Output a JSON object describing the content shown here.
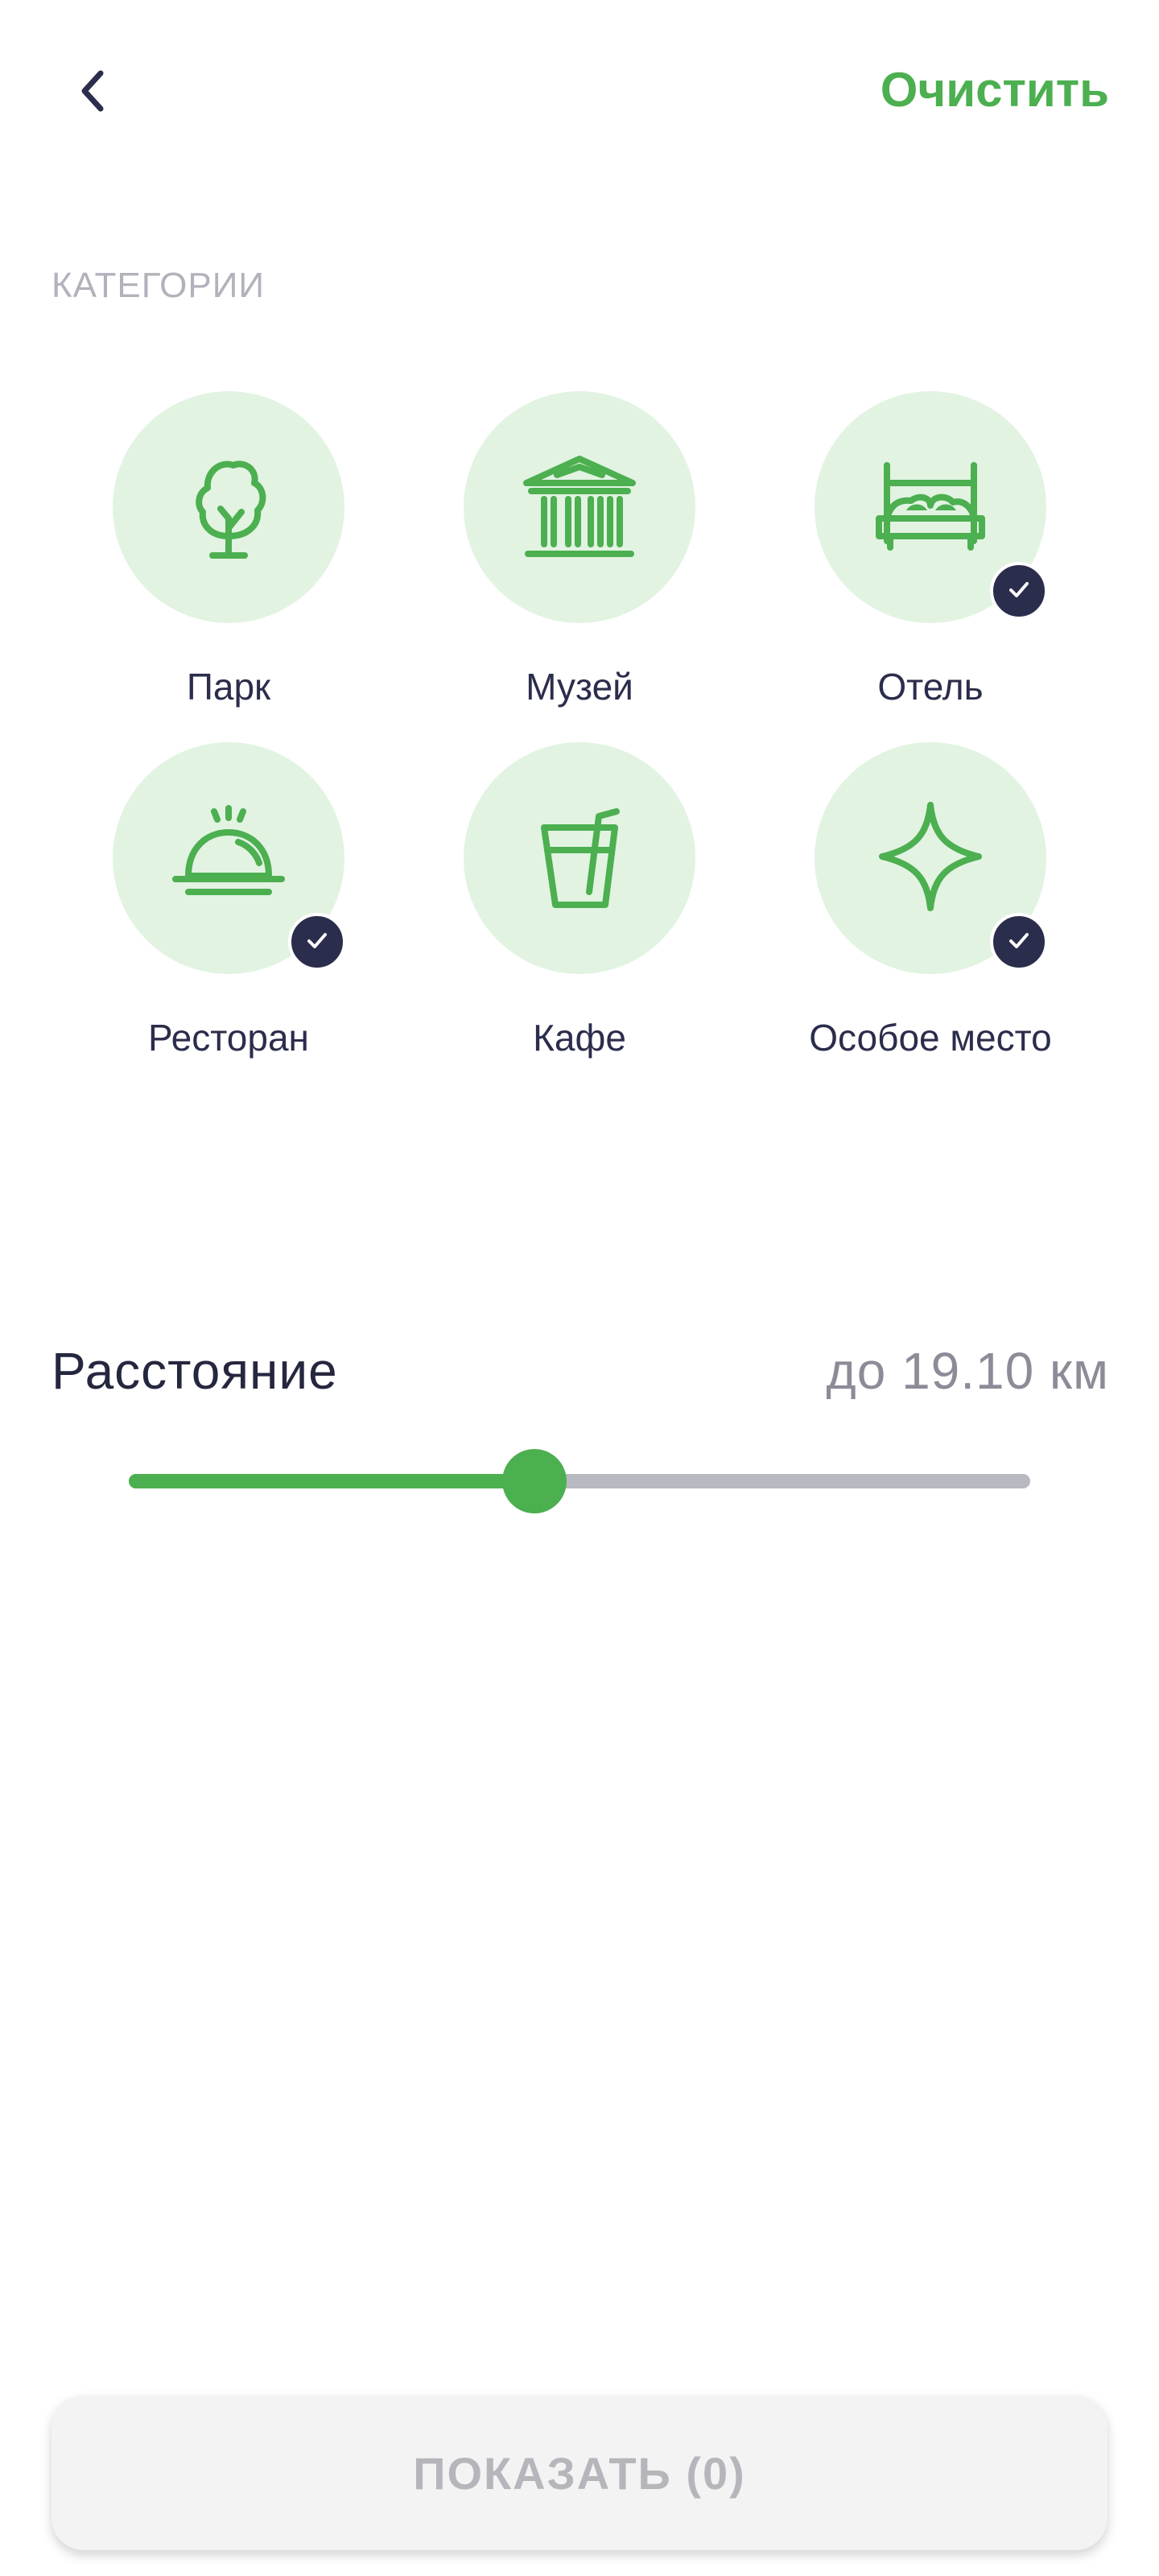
{
  "header": {
    "back_icon": "chevron-left-icon",
    "clear_label": "Очистить"
  },
  "categories": {
    "title": "КАТЕГОРИИ",
    "items": [
      {
        "label": "Парк",
        "icon": "tree-icon",
        "selected": false
      },
      {
        "label": "Музей",
        "icon": "museum-icon",
        "selected": false
      },
      {
        "label": "Отель",
        "icon": "bed-icon",
        "selected": true
      },
      {
        "label": "Ресторан",
        "icon": "cloche-icon",
        "selected": true
      },
      {
        "label": "Кафе",
        "icon": "drink-cup-icon",
        "selected": false
      },
      {
        "label": "Особое место",
        "icon": "sparkle-icon",
        "selected": true
      }
    ]
  },
  "distance": {
    "label": "Расстояние",
    "value": "до 19.10 км",
    "slider_fraction": 0.45
  },
  "show_button": {
    "label": "ПОКАЗАТЬ (0)"
  },
  "colors": {
    "accent": "#4caf50",
    "circle_bg": "#e2f3e2",
    "badge": "#2b2d4c",
    "text_dark": "#2b2d4c",
    "muted": "#b1b2bb"
  }
}
